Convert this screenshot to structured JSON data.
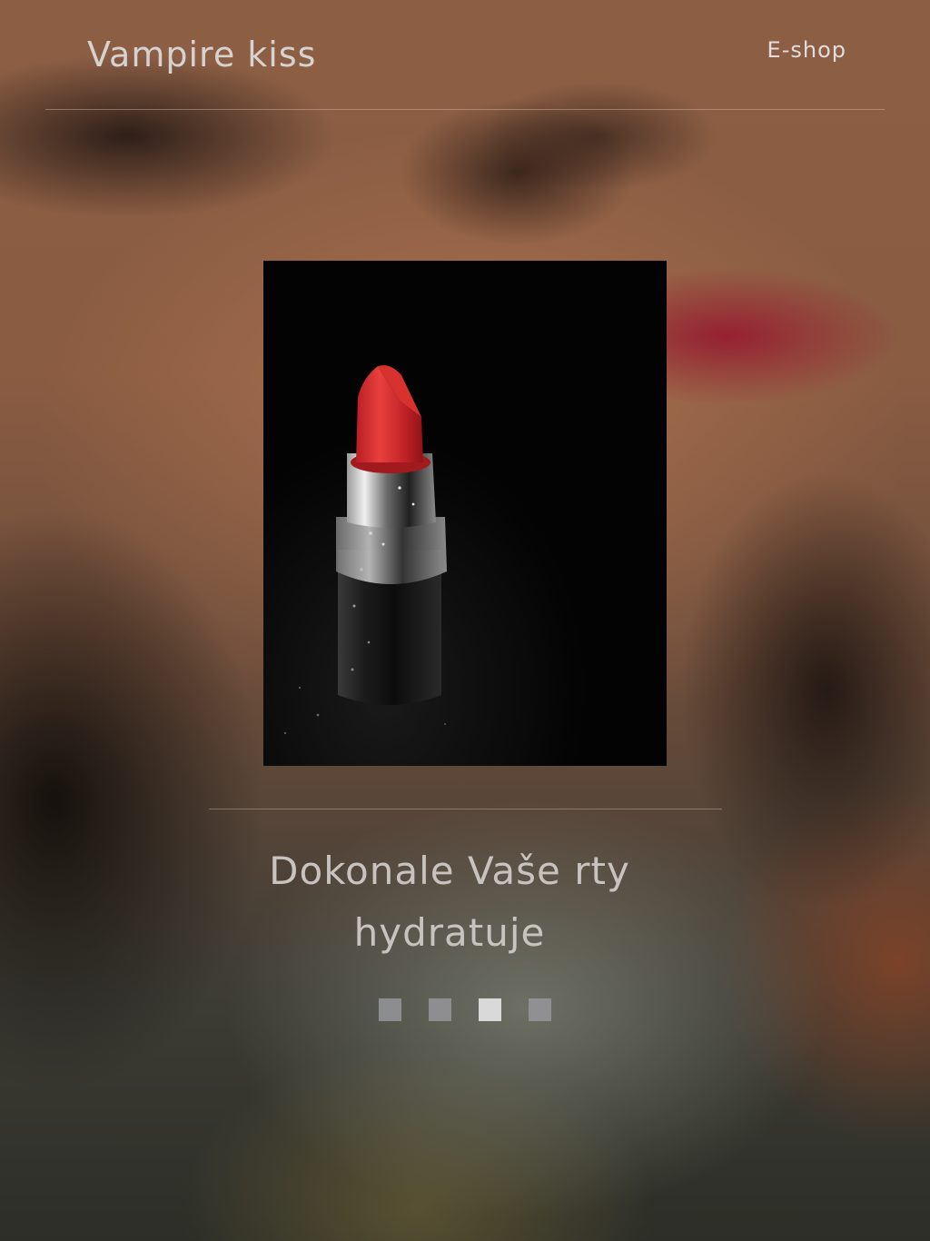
{
  "header": {
    "brand": "Vampire kiss",
    "nav_link": "E-shop"
  },
  "slider": {
    "caption_line1": "Dokonale Vaše rty",
    "caption_line2": "hydratuje",
    "slide_count": 4,
    "active_index": 2,
    "image_icon": "lipstick-photo"
  },
  "colors": {
    "lipstick_red": "#d42a2e",
    "active_dot": "#d9d9d9",
    "inactive_dot": "#96969b"
  }
}
